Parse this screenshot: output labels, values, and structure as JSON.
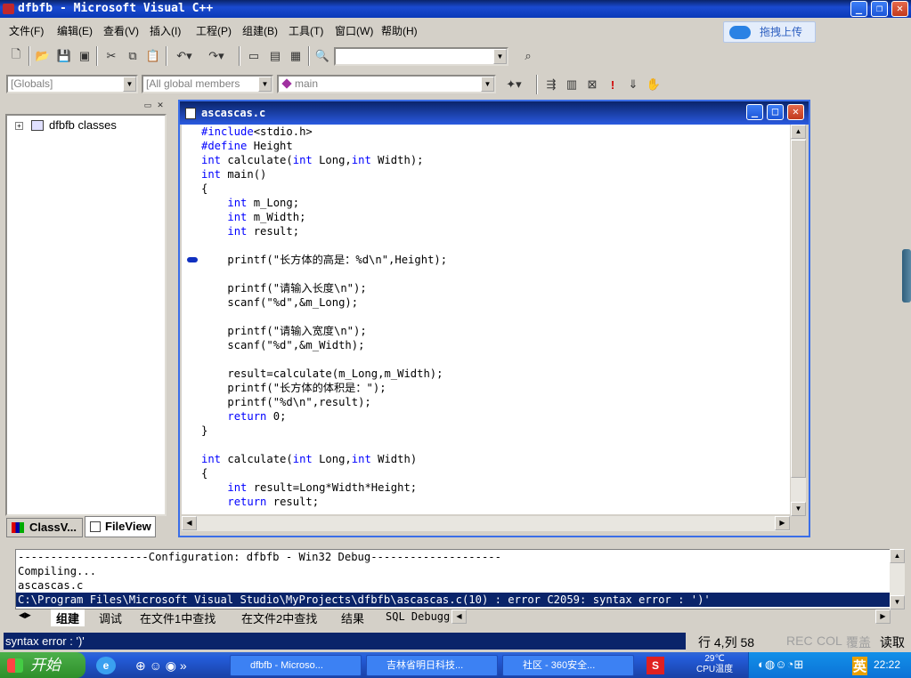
{
  "window": {
    "title": "dfbfb - Microsoft Visual C++"
  },
  "menu": [
    "文件(F)",
    "编辑(E)",
    "查看(V)",
    "插入(I)",
    "工程(P)",
    "组建(B)",
    "工具(T)",
    "窗口(W)",
    "帮助(H)"
  ],
  "upload_label": "拖拽上传",
  "combos": {
    "globals": "[Globals]",
    "members": "[All global members",
    "function": "main"
  },
  "classview": {
    "root": "dfbfb classes",
    "tab_class": "ClassV...",
    "tab_file": "FileView"
  },
  "editor": {
    "title": "ascascas.c",
    "lines": [
      {
        "pre": "",
        "kw": "#include",
        "post": "<stdio.h>"
      },
      {
        "pre": "",
        "kw": "#define",
        "post": " Height"
      },
      {
        "pre": "",
        "kw": "int",
        "post": " calculate(",
        "kw2": "int",
        "post2": " Long,",
        "kw3": "int",
        "post3": " Width);"
      },
      {
        "pre": "",
        "kw": "int",
        "post": " main()"
      },
      {
        "pre": "{",
        "kw": "",
        "post": ""
      },
      {
        "pre": "    ",
        "kw": "int",
        "post": " m_Long;"
      },
      {
        "pre": "    ",
        "kw": "int",
        "post": " m_Width;"
      },
      {
        "pre": "    ",
        "kw": "int",
        "post": " result;"
      },
      {
        "pre": "",
        "kw": "",
        "post": ""
      },
      {
        "pre": "    printf(\"长方体的高是：%d\\n\",Height);",
        "kw": "",
        "post": ""
      },
      {
        "pre": "",
        "kw": "",
        "post": ""
      },
      {
        "pre": "    printf(\"请输入长度\\n\");",
        "kw": "",
        "post": ""
      },
      {
        "pre": "    scanf(\"%d\",&m_Long);",
        "kw": "",
        "post": ""
      },
      {
        "pre": "",
        "kw": "",
        "post": ""
      },
      {
        "pre": "    printf(\"请输入宽度\\n\");",
        "kw": "",
        "post": ""
      },
      {
        "pre": "    scanf(\"%d\",&m_Width);",
        "kw": "",
        "post": ""
      },
      {
        "pre": "",
        "kw": "",
        "post": ""
      },
      {
        "pre": "    result=calculate(m_Long,m_Width);",
        "kw": "",
        "post": ""
      },
      {
        "pre": "    printf(\"长方体的体积是：\");",
        "kw": "",
        "post": ""
      },
      {
        "pre": "    printf(\"%d\\n\",result);",
        "kw": "",
        "post": ""
      },
      {
        "pre": "    ",
        "kw": "return",
        "post": " 0;"
      },
      {
        "pre": "}",
        "kw": "",
        "post": ""
      },
      {
        "pre": "",
        "kw": "",
        "post": ""
      },
      {
        "pre": "",
        "kw": "int",
        "post": " calculate(",
        "kw2": "int",
        "post2": " Long,",
        "kw3": "int",
        "post3": " Width)"
      },
      {
        "pre": "{",
        "kw": "",
        "post": ""
      },
      {
        "pre": "    ",
        "kw": "int",
        "post": " result=Long*Width*Height;"
      },
      {
        "pre": "    ",
        "kw": "return",
        "post": " result;"
      }
    ]
  },
  "output": {
    "lines": [
      "--------------------Configuration: dfbfb - Win32 Debug--------------------",
      "Compiling...",
      "ascascas.c"
    ],
    "error_line": "C:\\Program Files\\Microsoft Visual Studio\\MyProjects\\dfbfb\\ascascas.c(10) : error C2059: syntax error : ')'",
    "tabs": [
      "组建",
      "调试",
      "在文件1中查找",
      "在文件2中查找",
      "结果",
      "SQL Debugg"
    ]
  },
  "status": {
    "message": "syntax error : ')'",
    "position": "行 4,列 58",
    "rec": "REC",
    "col": "COL",
    "ovr": "覆盖",
    "read": "读取"
  },
  "taskbar": {
    "start": "开始",
    "tasks": [
      "dfbfb - Microso...",
      "吉林省明日科技...",
      "社区 - 360安全..."
    ],
    "temp": "29℃",
    "cpu": "CPU温度",
    "ime": "英",
    "time": "22:22"
  }
}
